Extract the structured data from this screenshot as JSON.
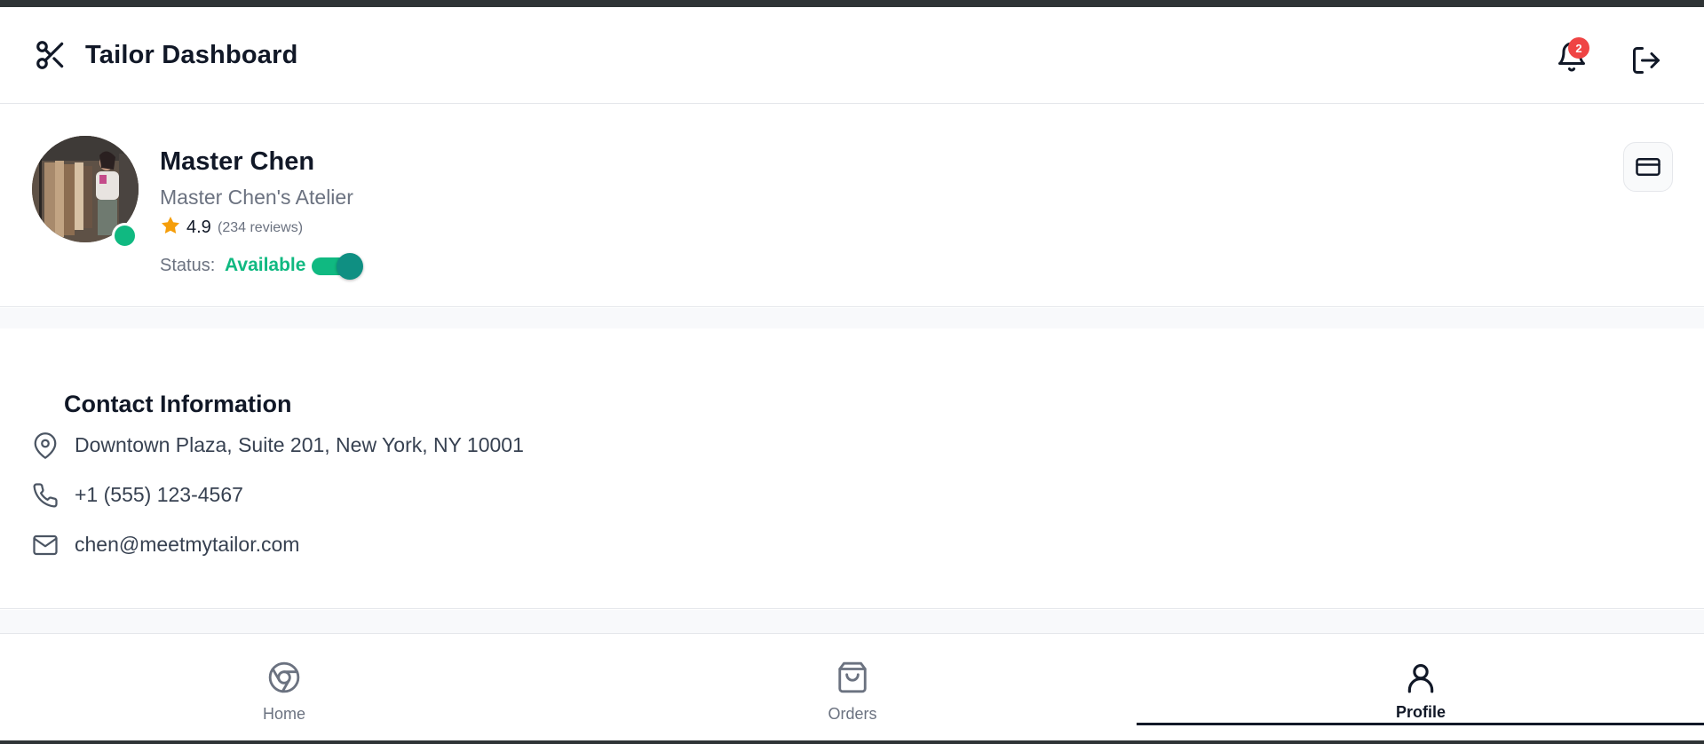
{
  "header": {
    "title": "Tailor Dashboard",
    "notification_count": "2"
  },
  "profile": {
    "name": "Master Chen",
    "shop": "Master Chen's Atelier",
    "rating": "4.9",
    "reviews": "(234 reviews)",
    "status_label": "Status:",
    "status_value": "Available",
    "available": true
  },
  "contact": {
    "title": "Contact Information",
    "address": "Downtown Plaza, Suite 201, New York, NY 10001",
    "phone": "+1 (555) 123-4567",
    "email": "chen@meetmytailor.com"
  },
  "nav": {
    "items": [
      {
        "label": "Home",
        "icon": "chrome-icon"
      },
      {
        "label": "Orders",
        "icon": "shopping-bag-icon"
      },
      {
        "label": "Profile",
        "icon": "user-icon"
      }
    ],
    "active": "Profile"
  },
  "colors": {
    "accent": "#10b981",
    "badge": "#ef4444",
    "star": "#f59e0b",
    "text_primary": "#111827",
    "text_muted": "#6b7280"
  }
}
